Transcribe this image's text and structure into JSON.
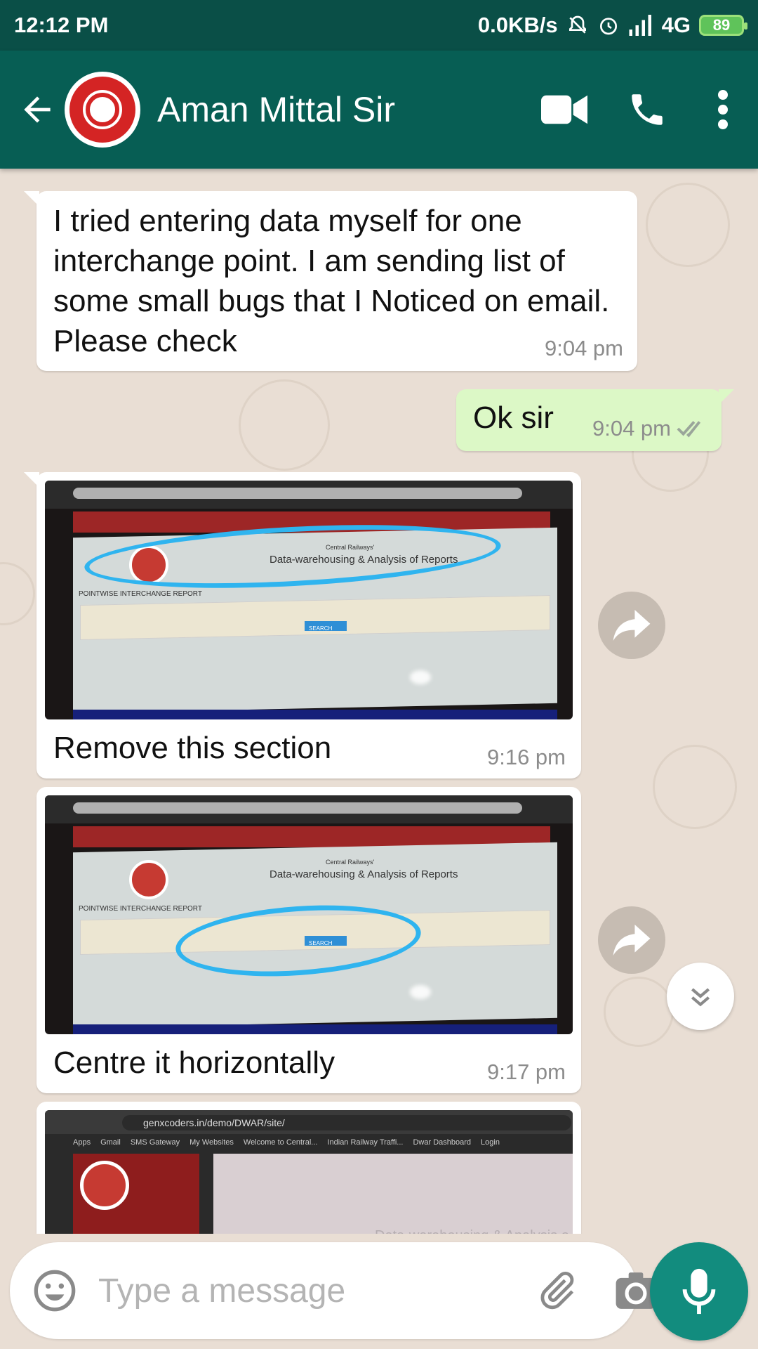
{
  "status_bar": {
    "time": "12:12 PM",
    "net_speed": "0.0KB/s",
    "network": "4G",
    "battery": "89"
  },
  "header": {
    "contact_name": "Aman Mittal Sir"
  },
  "messages": [
    {
      "type": "text",
      "direction": "incoming",
      "text": "I tried entering data myself for one interchange point. I am sending list of some small bugs that I Noticed on email. Please check",
      "time": "9:04 pm"
    },
    {
      "type": "text",
      "direction": "outgoing",
      "text": "Ok sir",
      "time": "9:04 pm",
      "status": "read"
    },
    {
      "type": "image",
      "direction": "incoming",
      "caption": "Remove this section",
      "time": "9:16 pm",
      "image_texts": {
        "org": "Central Railways'",
        "title": "Data-warehousing & Analysis of Reports",
        "section": "POINTWISE INTERCHANGE REPORT",
        "button": "SEARCH"
      }
    },
    {
      "type": "image",
      "direction": "incoming",
      "caption": "Centre it horizontally",
      "time": "9:17 pm",
      "image_texts": {
        "org": "Central Railways'",
        "title": "Data-warehousing & Analysis of Reports",
        "section": "POINTWISE INTERCHANGE REPORT",
        "button": "SEARCH"
      }
    },
    {
      "type": "image",
      "direction": "incoming",
      "image_texts": {
        "url": "genxcoders.in/demo/DWAR/site/",
        "bookmarks": [
          "Apps",
          "Gmail",
          "SMS Gateway",
          "My Websites",
          "Welcome to Central...",
          "Indian Railway Traffi...",
          "Dwar Dashboard",
          "Login"
        ],
        "title": "Data-warehousing & Analysis o"
      }
    }
  ],
  "composer": {
    "placeholder": "Type a message"
  },
  "colors": {
    "header": "#075e54",
    "status_bar": "#0a4f47",
    "outgoing_bubble": "#dcf8c6",
    "mic_button": "#128c7e",
    "annotation": "#2fb4ef"
  },
  "icons": [
    "back-arrow-icon",
    "video-call-icon",
    "voice-call-icon",
    "more-options-icon",
    "forward-icon",
    "scroll-down-icon",
    "emoji-icon",
    "attach-icon",
    "camera-icon",
    "mic-icon"
  ]
}
